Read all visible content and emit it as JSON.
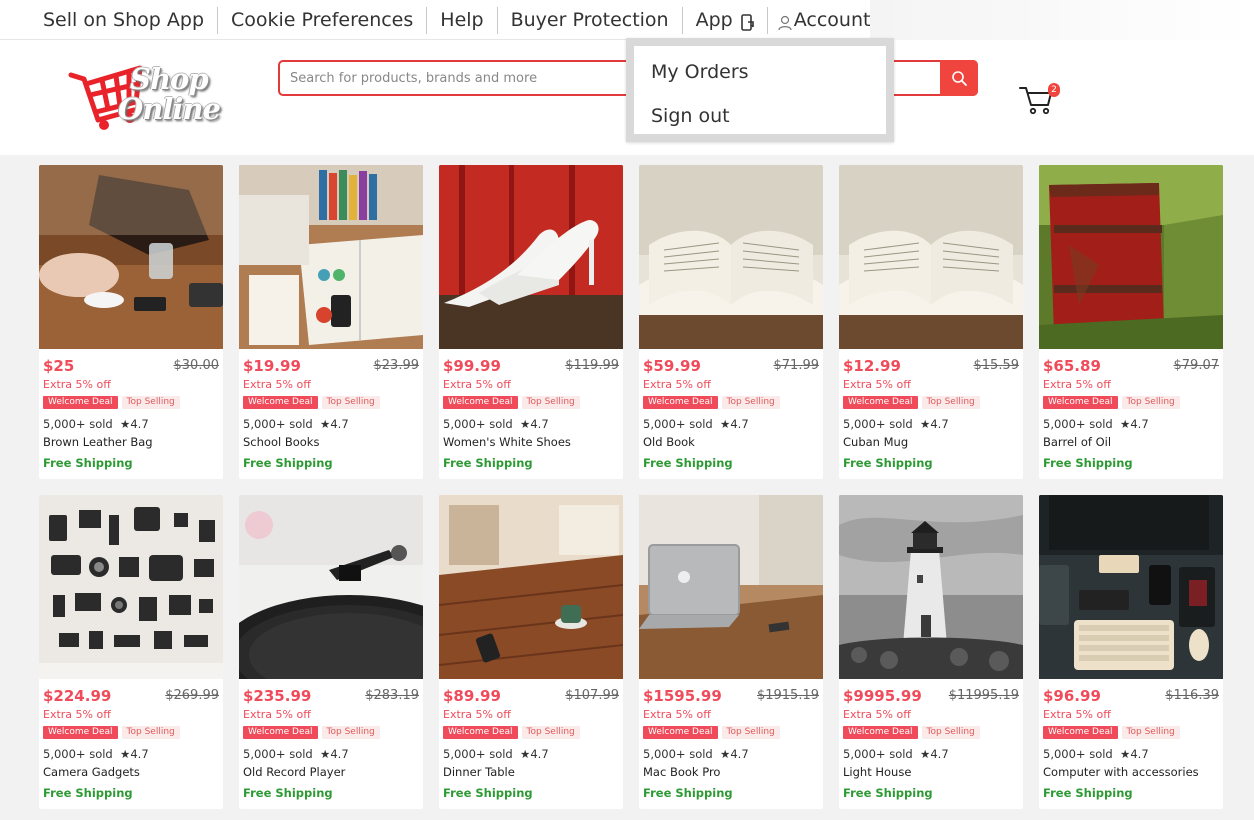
{
  "topnav": {
    "items": [
      "Sell on Shop App",
      "Cookie Preferences",
      "Help",
      "Buyer Protection",
      "App"
    ],
    "account_label": "Account"
  },
  "logo": {
    "line1": "Shop",
    "line2": "Online"
  },
  "search": {
    "placeholder": "Search for products, brands and more",
    "value": ""
  },
  "cart": {
    "count": "2"
  },
  "account_menu": {
    "items": [
      "My Orders",
      "Sign out"
    ]
  },
  "colors": {
    "accent": "#f04b5a",
    "search_border": "#e23a3a",
    "shipping": "#2e9a34"
  },
  "products": [
    {
      "price": "$25",
      "old_price": "$30.00",
      "extra": "Extra 5% off",
      "badge1": "Welcome Deal",
      "badge2": "Top Selling",
      "sold": "5,000+ sold  ★4.7",
      "name": "Brown Leather Bag",
      "shipping": "Free Shipping",
      "image": "bag-photo"
    },
    {
      "price": "$19.99",
      "old_price": "$23.99",
      "extra": "Extra 5% off",
      "badge1": "Welcome Deal",
      "badge2": "Top Selling",
      "sold": "5,000+ sold  ★4.7",
      "name": "School Books",
      "shipping": "Free Shipping",
      "image": "books-photo"
    },
    {
      "price": "$99.99",
      "old_price": "$119.99",
      "extra": "Extra 5% off",
      "badge1": "Welcome Deal",
      "badge2": "Top Selling",
      "sold": "5,000+ sold  ★4.7",
      "name": "Women's White Shoes",
      "shipping": "Free Shipping",
      "image": "shoes-photo"
    },
    {
      "price": "$59.99",
      "old_price": "$71.99",
      "extra": "Extra 5% off",
      "badge1": "Welcome Deal",
      "badge2": "Top Selling",
      "sold": "5,000+ sold  ★4.7",
      "name": "Old Book",
      "shipping": "Free Shipping",
      "image": "book-photo"
    },
    {
      "price": "$12.99",
      "old_price": "$15.59",
      "extra": "Extra 5% off",
      "badge1": "Welcome Deal",
      "badge2": "Top Selling",
      "sold": "5,000+ sold  ★4.7",
      "name": "Cuban Mug",
      "shipping": "Free Shipping",
      "image": "book-photo"
    },
    {
      "price": "$65.89",
      "old_price": "$79.07",
      "extra": "Extra 5% off",
      "badge1": "Welcome Deal",
      "badge2": "Top Selling",
      "sold": "5,000+ sold  ★4.7",
      "name": "Barrel of Oil",
      "shipping": "Free Shipping",
      "image": "barrel-photo"
    },
    {
      "price": "$224.99",
      "old_price": "$269.99",
      "extra": "Extra 5% off",
      "badge1": "Welcome Deal",
      "badge2": "Top Selling",
      "sold": "5,000+ sold  ★4.7",
      "name": "Camera Gadgets",
      "shipping": "Free Shipping",
      "image": "gadgets-photo"
    },
    {
      "price": "$235.99",
      "old_price": "$283.19",
      "extra": "Extra 5% off",
      "badge1": "Welcome Deal",
      "badge2": "Top Selling",
      "sold": "5,000+ sold  ★4.7",
      "name": "Old Record Player",
      "shipping": "Free Shipping",
      "image": "record-photo"
    },
    {
      "price": "$89.99",
      "old_price": "$107.99",
      "extra": "Extra 5% off",
      "badge1": "Welcome Deal",
      "badge2": "Top Selling",
      "sold": "5,000+ sold  ★4.7",
      "name": "Dinner Table",
      "shipping": "Free Shipping",
      "image": "table-photo"
    },
    {
      "price": "$1595.99",
      "old_price": "$1915.19",
      "extra": "Extra 5% off",
      "badge1": "Welcome Deal",
      "badge2": "Top Selling",
      "sold": "5,000+ sold  ★4.7",
      "name": "Mac Book Pro",
      "shipping": "Free Shipping",
      "image": "laptop-photo"
    },
    {
      "price": "$9995.99",
      "old_price": "$11995.19",
      "extra": "Extra 5% off",
      "badge1": "Welcome Deal",
      "badge2": "Top Selling",
      "sold": "5,000+ sold  ★4.7",
      "name": "Light House",
      "shipping": "Free Shipping",
      "image": "lighthouse-photo"
    },
    {
      "price": "$96.99",
      "old_price": "$116.39",
      "extra": "Extra 5% off",
      "badge1": "Welcome Deal",
      "badge2": "Top Selling",
      "sold": "5,000+ sold  ★4.7",
      "name": "Computer with accessories",
      "shipping": "Free Shipping",
      "image": "desk-photo"
    }
  ]
}
